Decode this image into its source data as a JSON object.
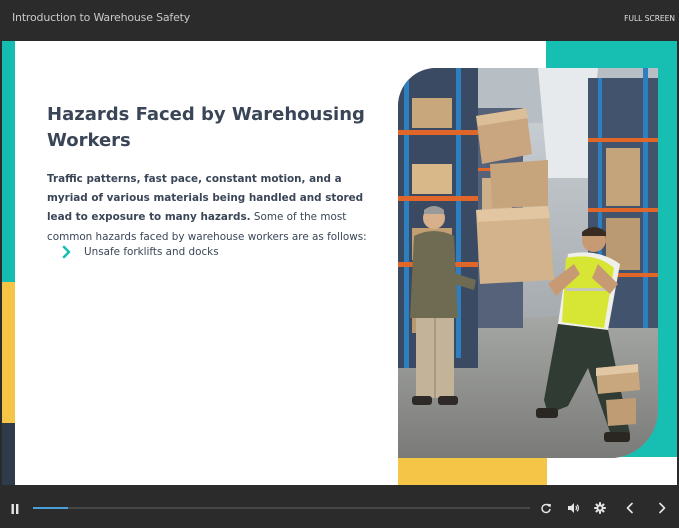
{
  "header": {
    "course_title": "Introduction to Warehouse Safety",
    "fullscreen_label": "FULL SCREEN"
  },
  "slide": {
    "heading": "Hazards Faced by Warehousing Workers",
    "body_bold": "Traffic patterns, fast pace, constant motion, and a myriad of various materials being handled and stored lead to exposure to many hazards.",
    "body_regular": " Some of the most common hazards faced by warehouse workers are as follows:",
    "bullets": [
      {
        "label": "Unsafe forklifts and docks",
        "icon": "chevron-right-icon"
      }
    ],
    "image": {
      "description": "warehouse workers-photo",
      "icon": "photo-illustration"
    }
  },
  "player": {
    "progress_fraction": 0.07,
    "icons": [
      "pause-icon",
      "replay-icon",
      "volume-icon",
      "settings-icon",
      "prev-icon",
      "next-icon"
    ]
  },
  "colors": {
    "teal": "#17bfb2",
    "yellow": "#f4c547",
    "navy": "#2f3a4a",
    "text": "#3a4657",
    "progress": "#4a9fd8",
    "chrome": "#2b2b2b"
  }
}
